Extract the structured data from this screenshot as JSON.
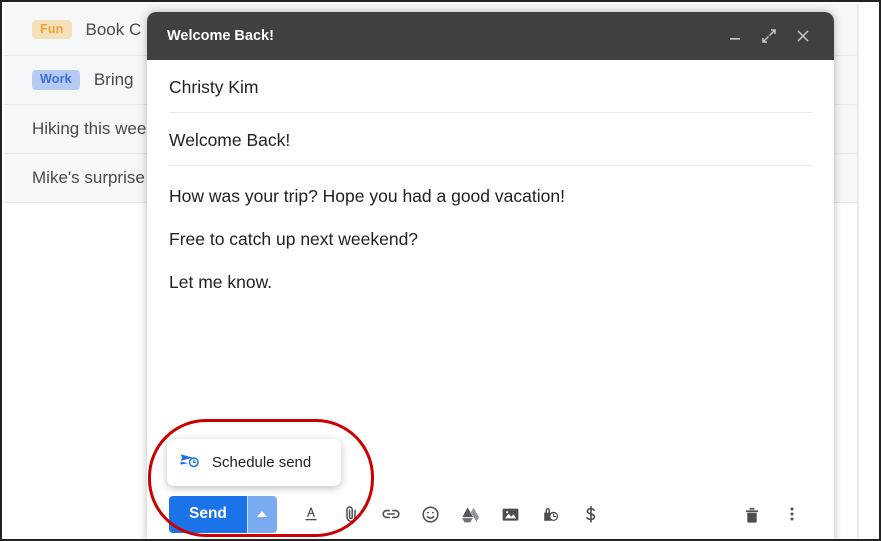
{
  "mail_list": {
    "rows": [
      {
        "chip": "Fun",
        "chip_color": "#e8a33d",
        "chip_bg": "#f6e0ba",
        "subject": "Book C"
      },
      {
        "chip": "Work",
        "chip_color": "#3b6ddb",
        "chip_bg": "#b6c9f3",
        "subject": "Bring"
      },
      {
        "chip": "",
        "chip_color": "",
        "chip_bg": "",
        "subject": "Hiking this wee"
      },
      {
        "chip": "",
        "chip_color": "",
        "chip_bg": "",
        "subject": "Mike's surprise"
      }
    ]
  },
  "compose": {
    "title": "Welcome Back!",
    "window_controls": {
      "minimize": "minimize-icon",
      "expand": "expand-icon",
      "close": "close-icon"
    },
    "recipient": "Christy Kim",
    "subject": "Welcome Back!",
    "body_paragraphs": [
      "How was your trip? Hope you had a good vacation!",
      "Free to catch up next weekend?",
      "Let me know."
    ],
    "toolbar": {
      "send_label": "Send",
      "send_color": "#1a73e8",
      "send_dropdown_color": "#7aaaf0",
      "icons": [
        {
          "name": "formatting-options-icon"
        },
        {
          "name": "attach-file-icon"
        },
        {
          "name": "insert-link-icon"
        },
        {
          "name": "insert-emoji-icon"
        },
        {
          "name": "insert-drive-icon"
        },
        {
          "name": "insert-photo-icon"
        },
        {
          "name": "confidential-mode-icon"
        },
        {
          "name": "insert-money-icon"
        }
      ],
      "right_icons": [
        {
          "name": "discard-draft-icon"
        },
        {
          "name": "more-options-icon"
        }
      ]
    }
  },
  "schedule_popup": {
    "label": "Schedule send",
    "icon": "schedule-send-icon",
    "icon_color": "#1a73e8"
  },
  "annotation": {
    "highlight_color": "#cc0000",
    "shape": "rounded-rectangle"
  }
}
